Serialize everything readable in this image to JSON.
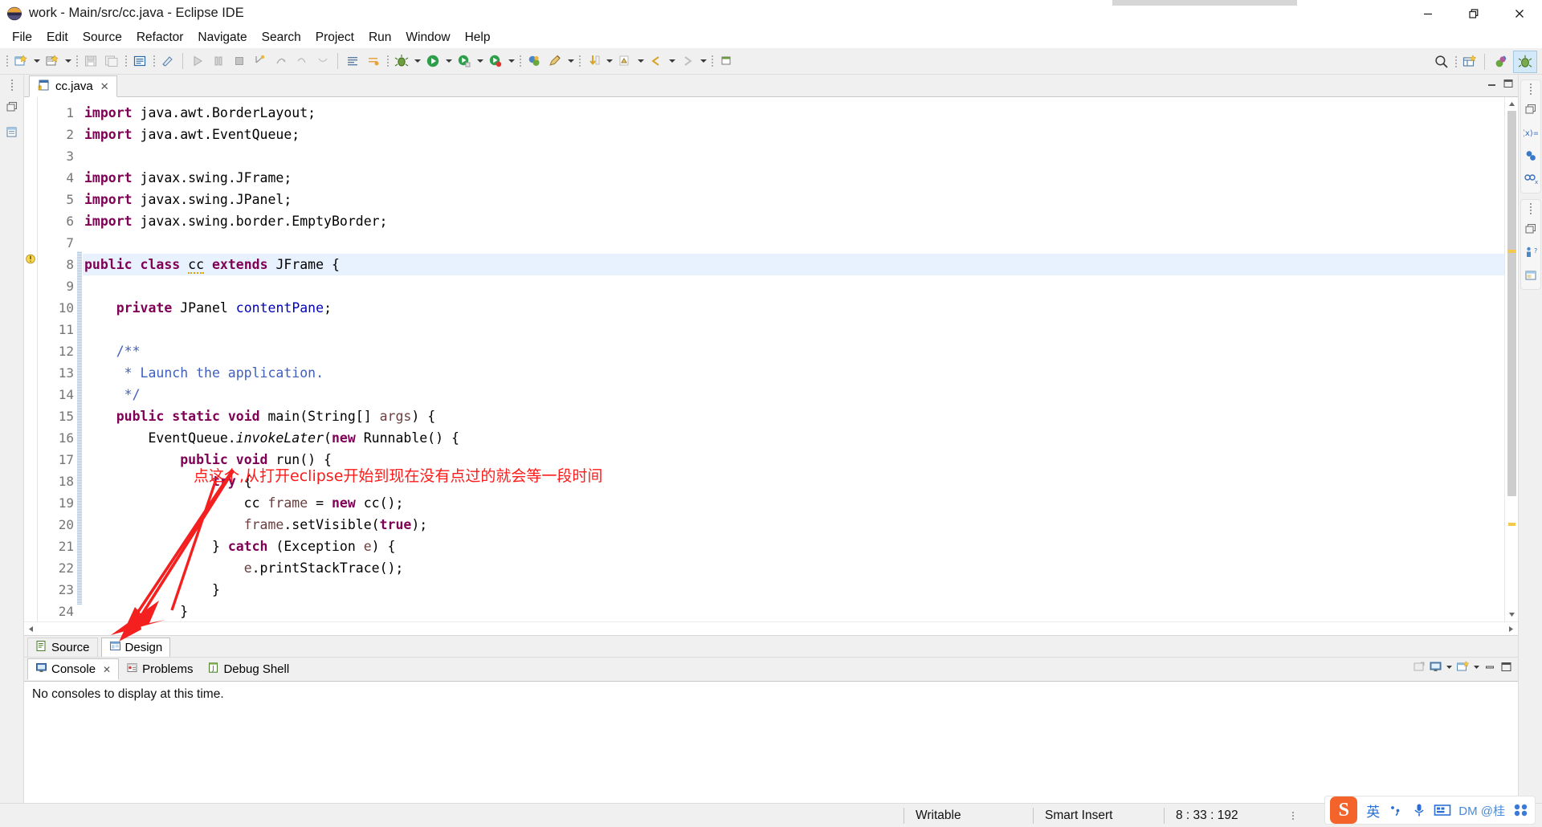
{
  "window": {
    "title": "work - Main/src/cc.java - Eclipse IDE",
    "icon": "eclipse-icon",
    "controls": {
      "minimize": "–",
      "restore": "❐",
      "close": "✕"
    }
  },
  "menubar": {
    "items": [
      {
        "label": "File"
      },
      {
        "label": "Edit"
      },
      {
        "label": "Source"
      },
      {
        "label": "Refactor"
      },
      {
        "label": "Navigate"
      },
      {
        "label": "Search"
      },
      {
        "label": "Project"
      },
      {
        "label": "Run"
      },
      {
        "label": "Window"
      },
      {
        "label": "Help"
      }
    ]
  },
  "toolbar": {
    "search_icon": "search-icon",
    "new_perspective_icon": "new-perspective-icon",
    "java_perspective_icon": "java-perspective-icon",
    "debug_perspective_icon": "debug-perspective-icon"
  },
  "editor": {
    "tab": {
      "label": "cc.java",
      "close": "✕",
      "icon": "java-file-warning-icon"
    },
    "filename": "cc.java",
    "lines": [
      {
        "n": 1,
        "tokens": [
          {
            "t": "import",
            "c": "k"
          },
          {
            "t": " java.awt.BorderLayout;",
            "c": "pl"
          }
        ]
      },
      {
        "n": 2,
        "tokens": [
          {
            "t": "import",
            "c": "k"
          },
          {
            "t": " java.awt.EventQueue;",
            "c": "pl"
          }
        ]
      },
      {
        "n": 3,
        "tokens": []
      },
      {
        "n": 4,
        "tokens": [
          {
            "t": "import",
            "c": "k"
          },
          {
            "t": " javax.swing.JFrame;",
            "c": "pl"
          }
        ]
      },
      {
        "n": 5,
        "tokens": [
          {
            "t": "import",
            "c": "k"
          },
          {
            "t": " javax.swing.JPanel;",
            "c": "pl"
          }
        ]
      },
      {
        "n": 6,
        "tokens": [
          {
            "t": "import",
            "c": "k"
          },
          {
            "t": " javax.swing.border.EmptyBorder;",
            "c": "pl"
          }
        ]
      },
      {
        "n": 7,
        "tokens": []
      },
      {
        "n": 8,
        "highlight": true,
        "marker": "warning",
        "tokens": [
          {
            "t": "public class",
            "c": "k"
          },
          {
            "t": " ",
            "c": "pl"
          },
          {
            "t": "cc",
            "c": "sq"
          },
          {
            "t": " ",
            "c": "pl"
          },
          {
            "t": "extends",
            "c": "k"
          },
          {
            "t": " JFrame {",
            "c": "pl"
          }
        ]
      },
      {
        "n": 9,
        "tokens": []
      },
      {
        "n": 10,
        "tokens": [
          {
            "t": "    ",
            "c": "pl"
          },
          {
            "t": "private",
            "c": "k"
          },
          {
            "t": " JPanel ",
            "c": "pl"
          },
          {
            "t": "contentPane",
            "c": "f"
          },
          {
            "t": ";",
            "c": "pl"
          }
        ]
      },
      {
        "n": 11,
        "tokens": []
      },
      {
        "n": 12,
        "tokens": [
          {
            "t": "    /**",
            "c": "cm"
          }
        ]
      },
      {
        "n": 13,
        "tokens": [
          {
            "t": "     * Launch the application.",
            "c": "cm"
          }
        ]
      },
      {
        "n": 14,
        "tokens": [
          {
            "t": "     */",
            "c": "cm"
          }
        ]
      },
      {
        "n": 15,
        "tokens": [
          {
            "t": "    ",
            "c": "pl"
          },
          {
            "t": "public static void",
            "c": "k"
          },
          {
            "t": " main(String[] ",
            "c": "pl"
          },
          {
            "t": "args",
            "c": "par"
          },
          {
            "t": ") {",
            "c": "pl"
          }
        ]
      },
      {
        "n": 16,
        "tokens": [
          {
            "t": "        EventQueue.",
            "c": "pl"
          },
          {
            "t": "invokeLater",
            "c": "mi"
          },
          {
            "t": "(",
            "c": "pl"
          },
          {
            "t": "new",
            "c": "k"
          },
          {
            "t": " Runnable() {",
            "c": "pl"
          }
        ]
      },
      {
        "n": 17,
        "tokens": [
          {
            "t": "            ",
            "c": "pl"
          },
          {
            "t": "public void",
            "c": "k"
          },
          {
            "t": " run() {",
            "c": "pl"
          }
        ]
      },
      {
        "n": 18,
        "tokens": [
          {
            "t": "                ",
            "c": "pl"
          },
          {
            "t": "try",
            "c": "k"
          },
          {
            "t": " {",
            "c": "pl"
          }
        ]
      },
      {
        "n": 19,
        "tokens": [
          {
            "t": "                    cc ",
            "c": "pl"
          },
          {
            "t": "frame",
            "c": "par"
          },
          {
            "t": " = ",
            "c": "pl"
          },
          {
            "t": "new",
            "c": "k"
          },
          {
            "t": " cc();",
            "c": "pl"
          }
        ]
      },
      {
        "n": 20,
        "tokens": [
          {
            "t": "                    ",
            "c": "pl"
          },
          {
            "t": "frame",
            "c": "par"
          },
          {
            "t": ".setVisible(",
            "c": "pl"
          },
          {
            "t": "true",
            "c": "k"
          },
          {
            "t": ");",
            "c": "pl"
          }
        ]
      },
      {
        "n": 21,
        "tokens": [
          {
            "t": "                } ",
            "c": "pl"
          },
          {
            "t": "catch",
            "c": "k"
          },
          {
            "t": " (Exception ",
            "c": "pl"
          },
          {
            "t": "e",
            "c": "par"
          },
          {
            "t": ") {",
            "c": "pl"
          }
        ]
      },
      {
        "n": 22,
        "tokens": [
          {
            "t": "                    ",
            "c": "pl"
          },
          {
            "t": "e",
            "c": "par"
          },
          {
            "t": ".printStackTrace();",
            "c": "pl"
          }
        ]
      },
      {
        "n": 23,
        "tokens": [
          {
            "t": "                }",
            "c": "pl"
          }
        ]
      },
      {
        "n": 24,
        "tokens": [
          {
            "t": "            }",
            "c": "pl"
          }
        ]
      }
    ]
  },
  "annotation": {
    "text": "点这个,从打开eclipse开始到现在没有点过的就会等一段时间",
    "color": "#ff1a1a",
    "arrow_target": "design-tab"
  },
  "source_design_tabs": {
    "items": [
      {
        "label": "Source",
        "active": true,
        "icon": "source-view-icon"
      },
      {
        "label": "Design",
        "active": false,
        "icon": "design-view-icon"
      }
    ]
  },
  "console": {
    "tabs": [
      {
        "label": "Console",
        "active": true,
        "icon": "console-icon",
        "close": "✕"
      },
      {
        "label": "Problems",
        "active": false,
        "icon": "problems-icon"
      },
      {
        "label": "Debug Shell",
        "active": false,
        "icon": "debug-shell-icon"
      }
    ],
    "message": "No consoles to display at this time.",
    "tools": [
      "open-console-icon",
      "display-selected-console-icon",
      "display-dropdown-icon",
      "new-console-view-icon",
      "new-console-dropdown-icon",
      "minimize-icon",
      "maximize-icon"
    ]
  },
  "statusbar": {
    "writable": "Writable",
    "insert_mode": "Smart Insert",
    "position": "8 : 33 : 192"
  },
  "ime": {
    "logo": "S",
    "mode": "英",
    "punctuation_icon": "punctuation-icon",
    "mic_icon": "microphone-icon",
    "keyboard_icon": "keyboard-icon",
    "label": "DM @桂",
    "menu_icon": "sogou-menu-icon"
  },
  "right_rail": {
    "restore_icon": "restore-view-icon",
    "variables_icon": "variables-icon",
    "breakpoints_icon": "breakpoints-icon",
    "expressions_icon": "expressions-icon",
    "outline_icon": "outline-icon",
    "task_list_icon": "task-list-icon"
  },
  "left_rail": {
    "restore_icon": "restore-view-icon",
    "package_explorer_icon": "package-explorer-icon"
  },
  "colors": {
    "keyword": "#7f0055",
    "comment": "#3f5fbf",
    "field": "#0000c0",
    "parameter": "#6a3e3e",
    "line_highlight": "#e8f2fe",
    "annotation": "#ff1a1a",
    "toolbar_bg": "#f0f0f0"
  }
}
